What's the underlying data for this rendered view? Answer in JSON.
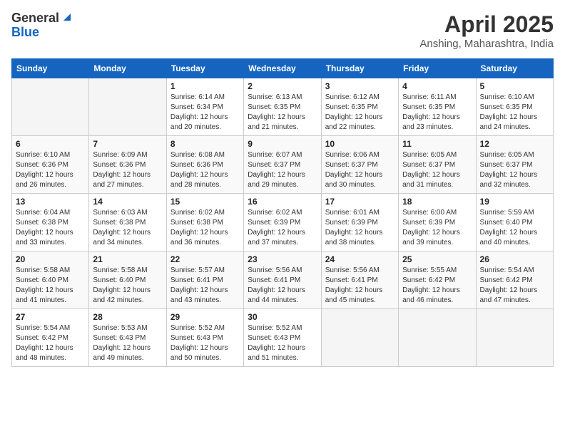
{
  "header": {
    "logo_general": "General",
    "logo_blue": "Blue",
    "month_year": "April 2025",
    "location": "Anshing, Maharashtra, India"
  },
  "calendar": {
    "days_of_week": [
      "Sunday",
      "Monday",
      "Tuesday",
      "Wednesday",
      "Thursday",
      "Friday",
      "Saturday"
    ],
    "weeks": [
      [
        {
          "day": "",
          "sunrise": "",
          "sunset": "",
          "daylight": ""
        },
        {
          "day": "",
          "sunrise": "",
          "sunset": "",
          "daylight": ""
        },
        {
          "day": "1",
          "sunrise": "Sunrise: 6:14 AM",
          "sunset": "Sunset: 6:34 PM",
          "daylight": "Daylight: 12 hours and 20 minutes."
        },
        {
          "day": "2",
          "sunrise": "Sunrise: 6:13 AM",
          "sunset": "Sunset: 6:35 PM",
          "daylight": "Daylight: 12 hours and 21 minutes."
        },
        {
          "day": "3",
          "sunrise": "Sunrise: 6:12 AM",
          "sunset": "Sunset: 6:35 PM",
          "daylight": "Daylight: 12 hours and 22 minutes."
        },
        {
          "day": "4",
          "sunrise": "Sunrise: 6:11 AM",
          "sunset": "Sunset: 6:35 PM",
          "daylight": "Daylight: 12 hours and 23 minutes."
        },
        {
          "day": "5",
          "sunrise": "Sunrise: 6:10 AM",
          "sunset": "Sunset: 6:35 PM",
          "daylight": "Daylight: 12 hours and 24 minutes."
        }
      ],
      [
        {
          "day": "6",
          "sunrise": "Sunrise: 6:10 AM",
          "sunset": "Sunset: 6:36 PM",
          "daylight": "Daylight: 12 hours and 26 minutes."
        },
        {
          "day": "7",
          "sunrise": "Sunrise: 6:09 AM",
          "sunset": "Sunset: 6:36 PM",
          "daylight": "Daylight: 12 hours and 27 minutes."
        },
        {
          "day": "8",
          "sunrise": "Sunrise: 6:08 AM",
          "sunset": "Sunset: 6:36 PM",
          "daylight": "Daylight: 12 hours and 28 minutes."
        },
        {
          "day": "9",
          "sunrise": "Sunrise: 6:07 AM",
          "sunset": "Sunset: 6:37 PM",
          "daylight": "Daylight: 12 hours and 29 minutes."
        },
        {
          "day": "10",
          "sunrise": "Sunrise: 6:06 AM",
          "sunset": "Sunset: 6:37 PM",
          "daylight": "Daylight: 12 hours and 30 minutes."
        },
        {
          "day": "11",
          "sunrise": "Sunrise: 6:05 AM",
          "sunset": "Sunset: 6:37 PM",
          "daylight": "Daylight: 12 hours and 31 minutes."
        },
        {
          "day": "12",
          "sunrise": "Sunrise: 6:05 AM",
          "sunset": "Sunset: 6:37 PM",
          "daylight": "Daylight: 12 hours and 32 minutes."
        }
      ],
      [
        {
          "day": "13",
          "sunrise": "Sunrise: 6:04 AM",
          "sunset": "Sunset: 6:38 PM",
          "daylight": "Daylight: 12 hours and 33 minutes."
        },
        {
          "day": "14",
          "sunrise": "Sunrise: 6:03 AM",
          "sunset": "Sunset: 6:38 PM",
          "daylight": "Daylight: 12 hours and 34 minutes."
        },
        {
          "day": "15",
          "sunrise": "Sunrise: 6:02 AM",
          "sunset": "Sunset: 6:38 PM",
          "daylight": "Daylight: 12 hours and 36 minutes."
        },
        {
          "day": "16",
          "sunrise": "Sunrise: 6:02 AM",
          "sunset": "Sunset: 6:39 PM",
          "daylight": "Daylight: 12 hours and 37 minutes."
        },
        {
          "day": "17",
          "sunrise": "Sunrise: 6:01 AM",
          "sunset": "Sunset: 6:39 PM",
          "daylight": "Daylight: 12 hours and 38 minutes."
        },
        {
          "day": "18",
          "sunrise": "Sunrise: 6:00 AM",
          "sunset": "Sunset: 6:39 PM",
          "daylight": "Daylight: 12 hours and 39 minutes."
        },
        {
          "day": "19",
          "sunrise": "Sunrise: 5:59 AM",
          "sunset": "Sunset: 6:40 PM",
          "daylight": "Daylight: 12 hours and 40 minutes."
        }
      ],
      [
        {
          "day": "20",
          "sunrise": "Sunrise: 5:58 AM",
          "sunset": "Sunset: 6:40 PM",
          "daylight": "Daylight: 12 hours and 41 minutes."
        },
        {
          "day": "21",
          "sunrise": "Sunrise: 5:58 AM",
          "sunset": "Sunset: 6:40 PM",
          "daylight": "Daylight: 12 hours and 42 minutes."
        },
        {
          "day": "22",
          "sunrise": "Sunrise: 5:57 AM",
          "sunset": "Sunset: 6:41 PM",
          "daylight": "Daylight: 12 hours and 43 minutes."
        },
        {
          "day": "23",
          "sunrise": "Sunrise: 5:56 AM",
          "sunset": "Sunset: 6:41 PM",
          "daylight": "Daylight: 12 hours and 44 minutes."
        },
        {
          "day": "24",
          "sunrise": "Sunrise: 5:56 AM",
          "sunset": "Sunset: 6:41 PM",
          "daylight": "Daylight: 12 hours and 45 minutes."
        },
        {
          "day": "25",
          "sunrise": "Sunrise: 5:55 AM",
          "sunset": "Sunset: 6:42 PM",
          "daylight": "Daylight: 12 hours and 46 minutes."
        },
        {
          "day": "26",
          "sunrise": "Sunrise: 5:54 AM",
          "sunset": "Sunset: 6:42 PM",
          "daylight": "Daylight: 12 hours and 47 minutes."
        }
      ],
      [
        {
          "day": "27",
          "sunrise": "Sunrise: 5:54 AM",
          "sunset": "Sunset: 6:42 PM",
          "daylight": "Daylight: 12 hours and 48 minutes."
        },
        {
          "day": "28",
          "sunrise": "Sunrise: 5:53 AM",
          "sunset": "Sunset: 6:43 PM",
          "daylight": "Daylight: 12 hours and 49 minutes."
        },
        {
          "day": "29",
          "sunrise": "Sunrise: 5:52 AM",
          "sunset": "Sunset: 6:43 PM",
          "daylight": "Daylight: 12 hours and 50 minutes."
        },
        {
          "day": "30",
          "sunrise": "Sunrise: 5:52 AM",
          "sunset": "Sunset: 6:43 PM",
          "daylight": "Daylight: 12 hours and 51 minutes."
        },
        {
          "day": "",
          "sunrise": "",
          "sunset": "",
          "daylight": ""
        },
        {
          "day": "",
          "sunrise": "",
          "sunset": "",
          "daylight": ""
        },
        {
          "day": "",
          "sunrise": "",
          "sunset": "",
          "daylight": ""
        }
      ]
    ]
  }
}
